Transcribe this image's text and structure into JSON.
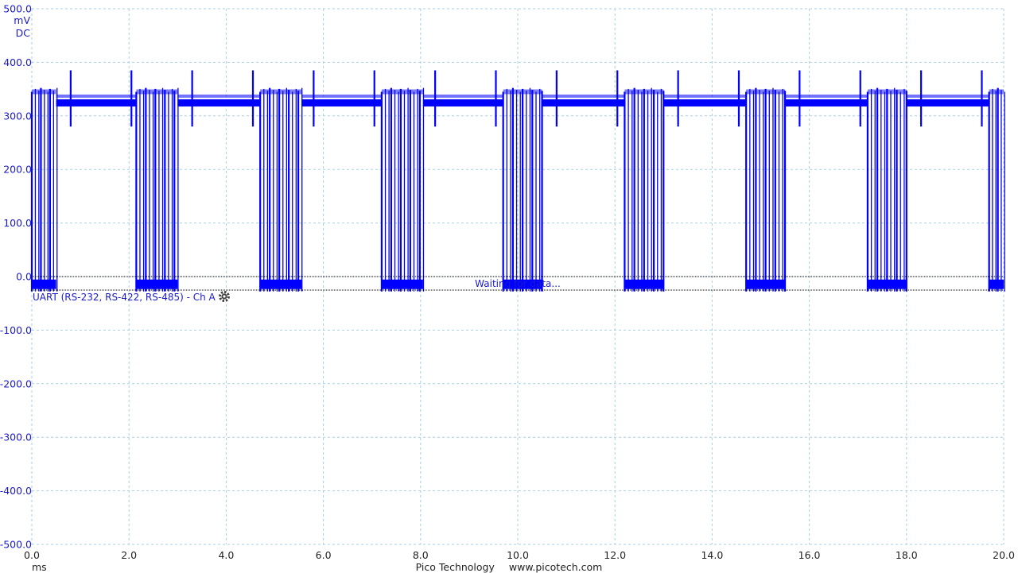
{
  "chart_data": {
    "type": "line",
    "title": "",
    "y_unit": "mV",
    "y_coupling": "DC",
    "x_unit": "ms",
    "xlim": [
      0.0,
      20.0
    ],
    "ylim": [
      -500.0,
      500.0
    ],
    "y_ticks": [
      "500.0",
      "400.0",
      "300.0",
      "200.0",
      "100.0",
      "0.0",
      "-100.0",
      "-200.0",
      "-300.0",
      "-400.0",
      "-500.0"
    ],
    "x_ticks": [
      "0.0",
      "2.0",
      "4.0",
      "6.0",
      "8.0",
      "10.0",
      "12.0",
      "14.0",
      "16.0",
      "18.0",
      "20.0"
    ],
    "grid": true,
    "series": [
      {
        "channel": "Ch A",
        "color": "#0000ff",
        "idle_level_mv": 325,
        "high_level_mv": 345,
        "low_level_mv": -10,
        "spike_peak_mv": 385,
        "frame_period_ms": 2.5,
        "burst_windows_ms": [
          [
            0.0,
            0.5
          ],
          [
            2.15,
            3.0
          ],
          [
            4.7,
            5.55
          ],
          [
            7.2,
            8.05
          ],
          [
            9.7,
            10.5
          ],
          [
            12.2,
            13.0
          ],
          [
            14.7,
            15.5
          ],
          [
            17.2,
            18.0
          ],
          [
            19.7,
            20.0
          ]
        ],
        "spike_times_ms": [
          0.8,
          2.05,
          3.3,
          4.55,
          5.8,
          7.05,
          8.3,
          9.55,
          10.8,
          12.05,
          13.3,
          14.55,
          15.8,
          17.05,
          18.3,
          19.55
        ]
      }
    ],
    "decoder": {
      "label": "UART (RS-232, RS-422, RS-485) - Ch A",
      "status": "Waiting for data..."
    },
    "footer": {
      "brand": "Pico Technology",
      "url": "www.picotech.com"
    }
  }
}
